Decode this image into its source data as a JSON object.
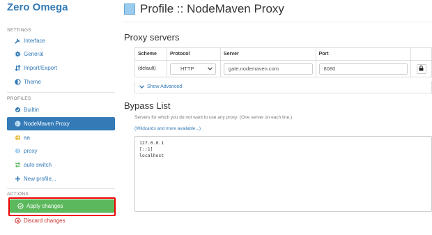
{
  "app": {
    "brand": "Zero Omega"
  },
  "sidebar": {
    "settings_title": "SETTINGS",
    "settings": [
      {
        "label": "Interface",
        "icon": "wrench-icon"
      },
      {
        "label": "General",
        "icon": "gear-icon"
      },
      {
        "label": "Import/Export",
        "icon": "transfer-icon"
      },
      {
        "label": "Theme",
        "icon": "theme-icon"
      }
    ],
    "profiles_title": "PROFILES",
    "profiles": [
      {
        "label": "Builtin",
        "icon": "builtin-icon"
      },
      {
        "label": "NodeMaven Proxy",
        "icon": "globe-icon",
        "active": true
      },
      {
        "label": "aa",
        "icon": "globe-icon"
      },
      {
        "label": "proxy",
        "icon": "globe-icon"
      },
      {
        "label": "auto switch",
        "icon": "switch-icon"
      },
      {
        "label": "New profile...",
        "icon": "plus-icon"
      }
    ],
    "actions_title": "ACTIONS",
    "apply_label": "Apply changes",
    "discard_label": "Discard changes"
  },
  "main": {
    "title": "Profile :: NodeMaven Proxy",
    "title_color": "#99ccee",
    "proxy_heading": "Proxy servers",
    "table": {
      "headers": [
        "Scheme",
        "Protocol",
        "Server",
        "Port"
      ],
      "row": {
        "scheme": "(default)",
        "protocol": "HTTP",
        "server": "gate.nodemaven.com",
        "port": "8080"
      }
    },
    "show_advanced": "Show Advanced",
    "bypass_heading": "Bypass List",
    "bypass_help": "Servers for which you do not want to use any proxy: (One server on each line.)",
    "bypass_link": "(Wildcards and more available...)",
    "bypass_lines": [
      "127.0.0.1",
      "[::1]",
      "localhost"
    ]
  },
  "colors": {
    "primary": "#337ab7",
    "success": "#5cb85c",
    "danger": "#c9302c",
    "highlight": "#ee0000"
  }
}
